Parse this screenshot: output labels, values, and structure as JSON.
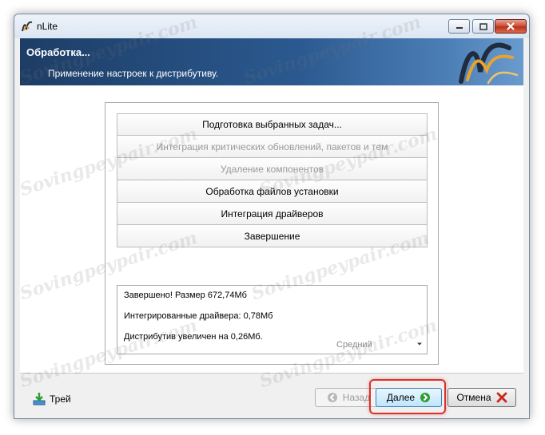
{
  "window": {
    "title": "nLite",
    "controls": [
      "minimize-icon",
      "maximize-icon",
      "close-icon"
    ]
  },
  "header": {
    "title": "Обработка...",
    "subtitle": "Применение настроек к дистрибутиву."
  },
  "tasks": [
    {
      "label": "Подготовка выбранных задач...",
      "state": "active"
    },
    {
      "label": "Интеграция критических обновлений, пакетов и тем",
      "state": "skipped"
    },
    {
      "label": "Удаление компонентов",
      "state": "skipped"
    },
    {
      "label": "Обработка файлов установки",
      "state": "done"
    },
    {
      "label": "Интеграция драйверов",
      "state": "done"
    },
    {
      "label": "Завершение",
      "state": "done"
    }
  ],
  "info": {
    "line1": "Завершено! Размер 672,74Мб",
    "line2": "Интегрированные драйвера: 0,78Мб",
    "line3": "Дистрибутив увеличен на 0,26Мб."
  },
  "priority": {
    "selected": "Средний"
  },
  "footer": {
    "tray_label": "Трей",
    "back_label": "Назад",
    "next_label": "Далее",
    "cancel_label": "Отмена"
  },
  "watermark": {
    "text": "Sovingpeypair.com"
  },
  "colors": {
    "header_dark": "#1d3d66",
    "header_light": "#6a9bcf",
    "highlight": "#d9312b",
    "next_icon": "#2e9e2e",
    "cancel_icon": "#c8281e"
  }
}
